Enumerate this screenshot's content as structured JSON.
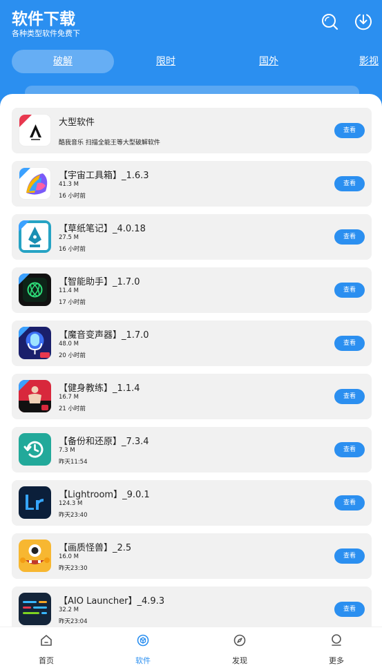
{
  "header": {
    "title": "软件下载",
    "subtitle": "各种类型软件免费下"
  },
  "tabs": [
    {
      "label": "破解"
    },
    {
      "label": "限时"
    },
    {
      "label": "国外"
    },
    {
      "label": "影视"
    }
  ],
  "apps": [
    {
      "name": "大型软件",
      "desc": "酷我音乐 扫描全能王等大型破解软件",
      "button": "查看",
      "icon": "a-logo-icon"
    },
    {
      "name": "【宇宙工具箱】_1.6.3",
      "size": "41.3 M",
      "time": "16 小时前",
      "button": "查看",
      "icon": "toolbox-icon"
    },
    {
      "name": "【草纸笔记】_4.0.18",
      "size": "27.5 M",
      "time": "16 小时前",
      "button": "查看",
      "icon": "pen-nib-icon"
    },
    {
      "name": "【智能助手】_1.7.0",
      "size": "11.4 M",
      "time": "17 小时前",
      "button": "查看",
      "icon": "ai-assistant-icon"
    },
    {
      "name": "【魔音变声器】_1.7.0",
      "size": "48.0 M",
      "time": "20 小时前",
      "button": "查看",
      "icon": "microphone-icon"
    },
    {
      "name": "【健身教练】_1.1.4",
      "size": "16.7 M",
      "time": "21 小时前",
      "button": "查看",
      "icon": "fitness-icon"
    },
    {
      "name": "【备份和还原】_7.3.4",
      "size": "7.3 M",
      "time": "昨天11:54",
      "button": "查看",
      "icon": "restore-icon"
    },
    {
      "name": "【Lightroom】_9.0.1",
      "size": "124.3 M",
      "time": "昨天23:40",
      "button": "查看",
      "icon": "lightroom-icon"
    },
    {
      "name": "【画质怪兽】_2.5",
      "size": "16.0 M",
      "time": "昨天23:30",
      "button": "查看",
      "icon": "monster-icon"
    },
    {
      "name": "【AIO Launcher】_4.9.3",
      "size": "32.2 M",
      "time": "昨天23:04",
      "button": "查看",
      "icon": "launcher-icon"
    }
  ],
  "nav": [
    {
      "label": "首页",
      "icon": "home-icon"
    },
    {
      "label": "软件",
      "icon": "software-box-icon"
    },
    {
      "label": "发现",
      "icon": "compass-icon"
    },
    {
      "label": "更多",
      "icon": "more-user-icon"
    }
  ],
  "colors": {
    "primary": "#2b8ff0",
    "card_bg": "#f1f1f1"
  }
}
